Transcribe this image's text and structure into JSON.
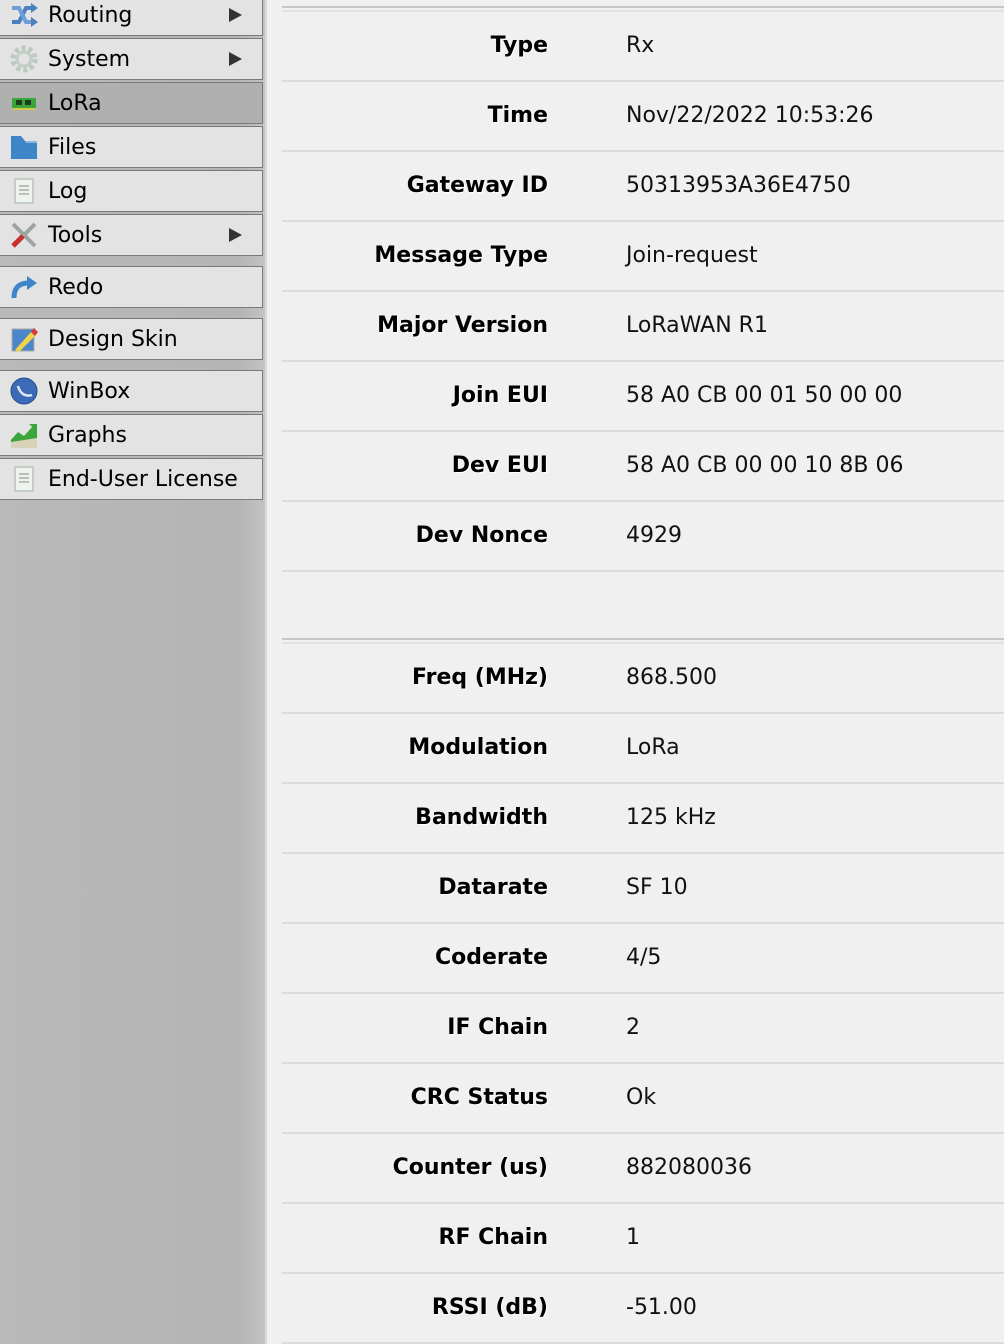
{
  "sidebar": {
    "items": [
      {
        "label": "Routing",
        "icon": "routing-icon",
        "has_submenu": true
      },
      {
        "label": "System",
        "icon": "gear-icon",
        "has_submenu": true
      },
      {
        "label": "LoRa",
        "icon": "lora-board-icon",
        "active": true
      },
      {
        "label": "Files",
        "icon": "folder-icon"
      },
      {
        "label": "Log",
        "icon": "log-icon"
      },
      {
        "label": "Tools",
        "icon": "tools-icon",
        "has_submenu": true
      },
      {
        "label": "Redo",
        "icon": "redo-icon"
      },
      {
        "label": "Design Skin",
        "icon": "design-skin-icon"
      },
      {
        "label": "WinBox",
        "icon": "winbox-icon"
      },
      {
        "label": "Graphs",
        "icon": "graphs-icon"
      },
      {
        "label": "End-User License",
        "icon": "license-icon"
      }
    ]
  },
  "details": {
    "section1": [
      {
        "key": "Type",
        "value": "Rx"
      },
      {
        "key": "Time",
        "value": "Nov/22/2022 10:53:26"
      },
      {
        "key": "Gateway ID",
        "value": "50313953A36E4750"
      },
      {
        "key": "Message Type",
        "value": "Join-request"
      },
      {
        "key": "Major Version",
        "value": "LoRaWAN R1"
      },
      {
        "key": "Join EUI",
        "value": "58 A0 CB 00 01 50 00 00"
      },
      {
        "key": "Dev EUI",
        "value": "58 A0 CB 00 00 10 8B 06"
      },
      {
        "key": "Dev Nonce",
        "value": "4929"
      }
    ],
    "section2": [
      {
        "key": "Freq (MHz)",
        "value": "868.500"
      },
      {
        "key": "Modulation",
        "value": "LoRa"
      },
      {
        "key": "Bandwidth",
        "value": "125 kHz"
      },
      {
        "key": "Datarate",
        "value": "SF 10"
      },
      {
        "key": "Coderate",
        "value": "4/5"
      },
      {
        "key": "IF Chain",
        "value": "2"
      },
      {
        "key": "CRC Status",
        "value": "Ok"
      },
      {
        "key": "Counter (us)",
        "value": "882080036"
      },
      {
        "key": "RF Chain",
        "value": "1"
      },
      {
        "key": "RSSI (dB)",
        "value": "-51.00"
      }
    ]
  }
}
